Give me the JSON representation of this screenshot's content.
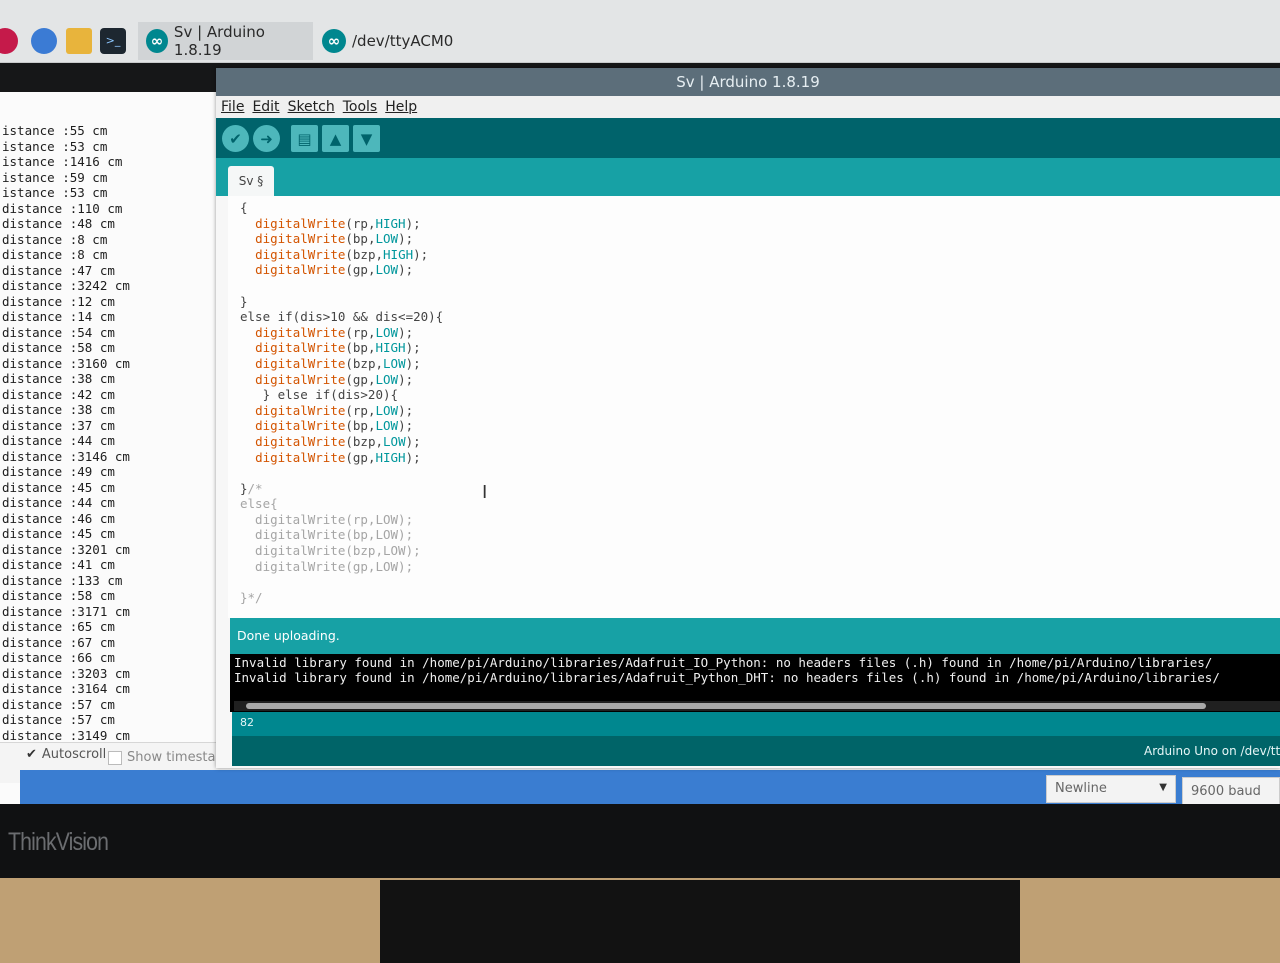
{
  "taskbar": {
    "icons": [
      "raspberry-icon",
      "globe-icon",
      "folder-icon",
      "terminal-icon"
    ],
    "terminal_glyph": ">_",
    "tasks": [
      {
        "label": "Sv | Arduino 1.8.19"
      },
      {
        "label": "/dev/ttyACM0"
      }
    ]
  },
  "serial_monitor": {
    "lines": [
      "istance :55 cm",
      "istance :53 cm",
      "istance :1416 cm",
      "istance :59 cm",
      "istance :53 cm",
      "distance :110 cm",
      "distance :48 cm",
      "distance :8 cm",
      "distance :8 cm",
      "distance :47 cm",
      "distance :3242 cm",
      "distance :12 cm",
      "distance :14 cm",
      "distance :54 cm",
      "distance :58 cm",
      "distance :3160 cm",
      "distance :38 cm",
      "distance :42 cm",
      "distance :38 cm",
      "distance :37 cm",
      "distance :44 cm",
      "distance :3146 cm",
      "distance :49 cm",
      "distance :45 cm",
      "distance :44 cm",
      "distance :46 cm",
      "distance :45 cm",
      "distance :3201 cm",
      "distance :41 cm",
      "distance :133 cm",
      "distance :58 cm",
      "distance :3171 cm",
      "distance :65 cm",
      "distance :67 cm",
      "distance :66 cm",
      "distance :3203 cm",
      "distance :3164 cm",
      "distance :57 cm",
      "distance :57 cm",
      "distance :3149 cm"
    ],
    "autoscroll_label": "Autoscroll",
    "autoscroll_checked": true,
    "timestamp_label": "Show timestamp",
    "line_ending": "Newline",
    "baud": "9600 baud"
  },
  "ide": {
    "title": "Sv | Arduino 1.8.19",
    "menu": [
      "File",
      "Edit",
      "Sketch",
      "Tools",
      "Help"
    ],
    "toolbar": [
      "verify-button",
      "upload-button",
      "new-button",
      "open-button",
      "save-button"
    ],
    "tab_label": "Sv §",
    "code_lines": [
      [
        {
          "t": "{",
          "c": ""
        }
      ],
      [
        {
          "t": "  ",
          "c": ""
        },
        {
          "t": "digitalWrite",
          "c": "fn"
        },
        {
          "t": "(rp,",
          "c": ""
        },
        {
          "t": "HIGH",
          "c": "kw"
        },
        {
          "t": ");",
          "c": ""
        }
      ],
      [
        {
          "t": "  ",
          "c": ""
        },
        {
          "t": "digitalWrite",
          "c": "fn"
        },
        {
          "t": "(bp,",
          "c": ""
        },
        {
          "t": "LOW",
          "c": "kw"
        },
        {
          "t": ");",
          "c": ""
        }
      ],
      [
        {
          "t": "  ",
          "c": ""
        },
        {
          "t": "digitalWrite",
          "c": "fn"
        },
        {
          "t": "(bzp,",
          "c": ""
        },
        {
          "t": "HIGH",
          "c": "kw"
        },
        {
          "t": ");",
          "c": ""
        }
      ],
      [
        {
          "t": "  ",
          "c": ""
        },
        {
          "t": "digitalWrite",
          "c": "fn"
        },
        {
          "t": "(gp,",
          "c": ""
        },
        {
          "t": "LOW",
          "c": "kw"
        },
        {
          "t": ");",
          "c": ""
        }
      ],
      [
        {
          "t": "",
          "c": ""
        }
      ],
      [
        {
          "t": "}",
          "c": ""
        }
      ],
      [
        {
          "t": "else if(dis>10 && dis<=20){",
          "c": ""
        }
      ],
      [
        {
          "t": "  ",
          "c": ""
        },
        {
          "t": "digitalWrite",
          "c": "fn"
        },
        {
          "t": "(rp,",
          "c": ""
        },
        {
          "t": "LOW",
          "c": "kw"
        },
        {
          "t": ");",
          "c": ""
        }
      ],
      [
        {
          "t": "  ",
          "c": ""
        },
        {
          "t": "digitalWrite",
          "c": "fn"
        },
        {
          "t": "(bp,",
          "c": ""
        },
        {
          "t": "HIGH",
          "c": "kw"
        },
        {
          "t": ");",
          "c": ""
        }
      ],
      [
        {
          "t": "  ",
          "c": ""
        },
        {
          "t": "digitalWrite",
          "c": "fn"
        },
        {
          "t": "(bzp,",
          "c": ""
        },
        {
          "t": "LOW",
          "c": "kw"
        },
        {
          "t": ");",
          "c": ""
        }
      ],
      [
        {
          "t": "  ",
          "c": ""
        },
        {
          "t": "digitalWrite",
          "c": "fn"
        },
        {
          "t": "(gp,",
          "c": ""
        },
        {
          "t": "LOW",
          "c": "kw"
        },
        {
          "t": ");",
          "c": ""
        }
      ],
      [
        {
          "t": "   } else if(dis>20){",
          "c": ""
        }
      ],
      [
        {
          "t": "  ",
          "c": ""
        },
        {
          "t": "digitalWrite",
          "c": "fn"
        },
        {
          "t": "(rp,",
          "c": ""
        },
        {
          "t": "LOW",
          "c": "kw"
        },
        {
          "t": ");",
          "c": ""
        }
      ],
      [
        {
          "t": "  ",
          "c": ""
        },
        {
          "t": "digitalWrite",
          "c": "fn"
        },
        {
          "t": "(bp,",
          "c": ""
        },
        {
          "t": "LOW",
          "c": "kw"
        },
        {
          "t": ");",
          "c": ""
        }
      ],
      [
        {
          "t": "  ",
          "c": ""
        },
        {
          "t": "digitalWrite",
          "c": "fn"
        },
        {
          "t": "(bzp,",
          "c": ""
        },
        {
          "t": "LOW",
          "c": "kw"
        },
        {
          "t": ");",
          "c": ""
        }
      ],
      [
        {
          "t": "  ",
          "c": ""
        },
        {
          "t": "digitalWrite",
          "c": "fn"
        },
        {
          "t": "(gp,",
          "c": ""
        },
        {
          "t": "HIGH",
          "c": "kw"
        },
        {
          "t": ");",
          "c": ""
        }
      ],
      [
        {
          "t": "",
          "c": ""
        }
      ],
      [
        {
          "t": "}",
          "c": ""
        },
        {
          "t": "/*",
          "c": "cm"
        }
      ],
      [
        {
          "t": "else{",
          "c": "cm"
        }
      ],
      [
        {
          "t": "  digitalWrite(rp,LOW);",
          "c": "cm"
        }
      ],
      [
        {
          "t": "  digitalWrite(bp,LOW);",
          "c": "cm"
        }
      ],
      [
        {
          "t": "  digitalWrite(bzp,LOW);",
          "c": "cm"
        }
      ],
      [
        {
          "t": "  digitalWrite(gp,LOW);",
          "c": "cm"
        }
      ],
      [
        {
          "t": "",
          "c": ""
        }
      ],
      [
        {
          "t": "}*/",
          "c": "cm"
        }
      ]
    ],
    "status": "Done uploading.",
    "console": [
      "Invalid library found in /home/pi/Arduino/libraries/Adafruit_IO_Python: no headers files (.h) found in /home/pi/Arduino/libraries/",
      "Invalid library found in /home/pi/Arduino/libraries/Adafruit_Python_DHT: no headers files (.h) found in /home/pi/Arduino/libraries/"
    ],
    "line_number": "82",
    "board": "Arduino Uno on /dev/tty"
  },
  "monitor": {
    "brand": "ThinkVision"
  },
  "colors": {
    "teal_dark": "#00636b",
    "teal": "#17a1a5",
    "keyword": "#00979c",
    "function": "#d35400",
    "comment": "#a5a5a5"
  }
}
